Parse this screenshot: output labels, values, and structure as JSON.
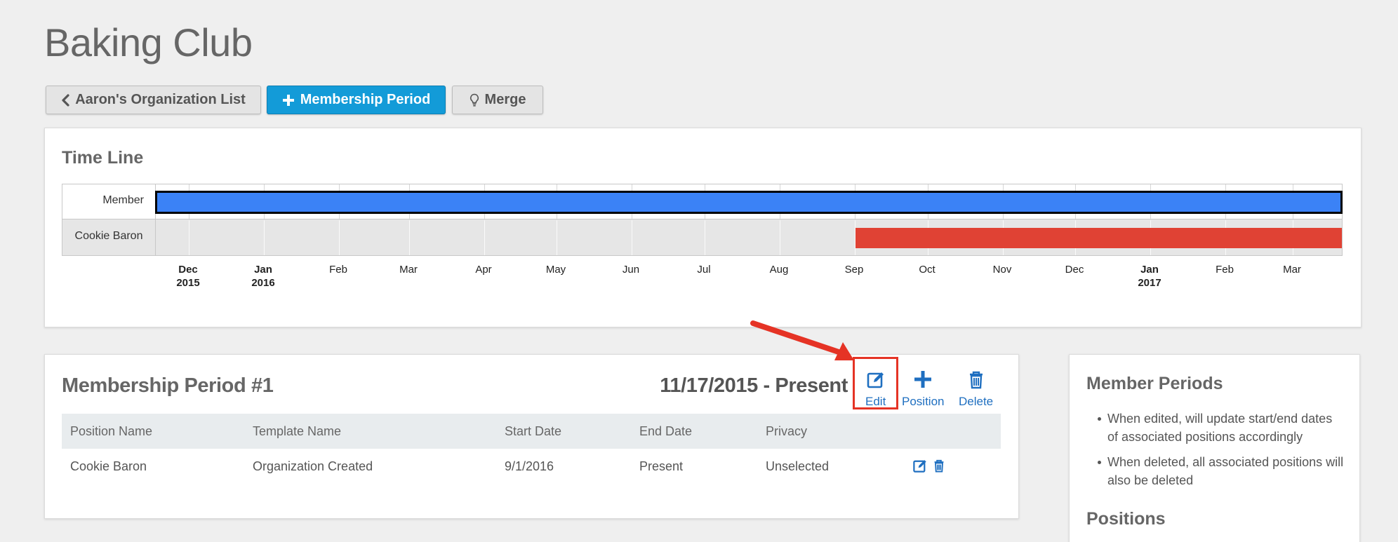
{
  "page": {
    "title": "Baking Club"
  },
  "toolbar": {
    "back_label": "Aaron's Organization List",
    "add_period_label": "Membership Period",
    "merge_label": "Merge"
  },
  "timeline": {
    "title": "Time Line",
    "rows": [
      {
        "label": "Member",
        "bar_color": "#3b82f6",
        "start_fraction": 0.0,
        "end_fraction": 1.0
      },
      {
        "label": "Cookie Baron",
        "bar_color": "#e04234",
        "start_fraction": 0.59,
        "end_fraction": 1.0
      }
    ],
    "ticks": [
      {
        "month": "Dec",
        "year": "2015"
      },
      {
        "month": "Jan",
        "year": "2016"
      },
      {
        "month": "Feb",
        "year": ""
      },
      {
        "month": "Mar",
        "year": ""
      },
      {
        "month": "Apr",
        "year": ""
      },
      {
        "month": "May",
        "year": ""
      },
      {
        "month": "Jun",
        "year": ""
      },
      {
        "month": "Jul",
        "year": ""
      },
      {
        "month": "Aug",
        "year": ""
      },
      {
        "month": "Sep",
        "year": ""
      },
      {
        "month": "Oct",
        "year": ""
      },
      {
        "month": "Nov",
        "year": ""
      },
      {
        "month": "Dec",
        "year": ""
      },
      {
        "month": "Jan",
        "year": "2017"
      },
      {
        "month": "Feb",
        "year": ""
      },
      {
        "month": "Mar",
        "year": ""
      }
    ]
  },
  "membership": {
    "title": "Membership Period #1",
    "date_range": "11/17/2015 - Present",
    "actions": {
      "edit": "Edit",
      "position": "Position",
      "delete": "Delete"
    },
    "columns": [
      "Position Name",
      "Template Name",
      "Start Date",
      "End Date",
      "Privacy"
    ],
    "rows": [
      {
        "position": "Cookie Baron",
        "template": "Organization Created",
        "start": "9/1/2016",
        "end": "Present",
        "privacy": "Unselected"
      }
    ]
  },
  "sidebar": {
    "title": "Member Periods",
    "notes": [
      "When edited, will update start/end dates of associated positions accordingly",
      "When deleted, all associated positions will also be deleted"
    ],
    "positions_title": "Positions"
  },
  "colors": {
    "accent": "#139bd8",
    "link": "#1f6fc0",
    "annotation": "#e53325"
  }
}
